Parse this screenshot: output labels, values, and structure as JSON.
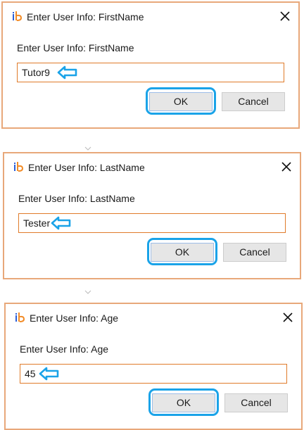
{
  "colors": {
    "dialog_border": "#e8a87a",
    "field_border": "#e07b2a",
    "highlight": "#1aa3e8",
    "logo_blue": "#2b5fd9",
    "logo_orange": "#f28c28"
  },
  "dialogs": [
    {
      "title": "Enter User Info: FirstName",
      "prompt": "Enter User Info: FirstName",
      "value": "Tutor9",
      "ok_label": "OK",
      "cancel_label": "Cancel"
    },
    {
      "title": "Enter User Info: LastName",
      "prompt": "Enter User Info: LastName",
      "value": "Tester",
      "ok_label": "OK",
      "cancel_label": "Cancel"
    },
    {
      "title": "Enter User Info: Age",
      "prompt": "Enter User Info: Age",
      "value": "45",
      "ok_label": "OK",
      "cancel_label": "Cancel"
    }
  ],
  "icons": {
    "logo": "ib-logo-icon",
    "close": "close-icon",
    "callout": "arrow-left-icon"
  }
}
